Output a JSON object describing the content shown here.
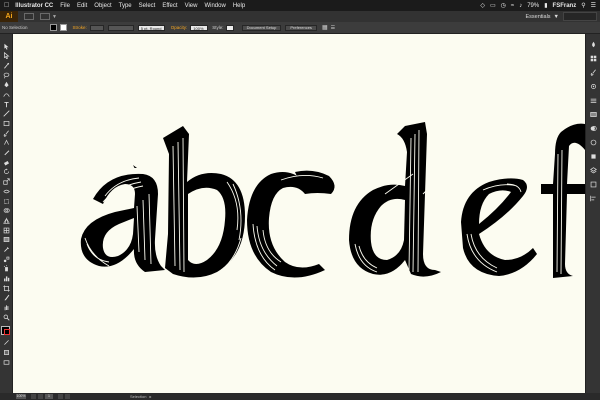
{
  "menubar": {
    "apple": "",
    "app_name": "Illustrator CC",
    "items": [
      "File",
      "Edit",
      "Object",
      "Type",
      "Select",
      "Effect",
      "View",
      "Window",
      "Help"
    ],
    "battery": "79%",
    "user": "FSFranz"
  },
  "appbar": {
    "logo": "Ai",
    "workspace": "Essentials"
  },
  "control": {
    "selection": "No Selection",
    "stroke_label": "Stroke:",
    "brush": "5 pt. Round",
    "opacity_label": "Opacity:",
    "opacity_value": "100%",
    "style_label": "Style:",
    "doc_setup": "Document Setup",
    "preferences": "Preferences",
    "colors": {
      "fill": "#000000",
      "stroke": "#ffffff",
      "accent": "#f5a623"
    }
  },
  "canvas": {
    "background": "#fcfcf1",
    "letters": "abcdef"
  },
  "status": {
    "zoom": "100%",
    "page": "1",
    "tool": "Selection"
  }
}
